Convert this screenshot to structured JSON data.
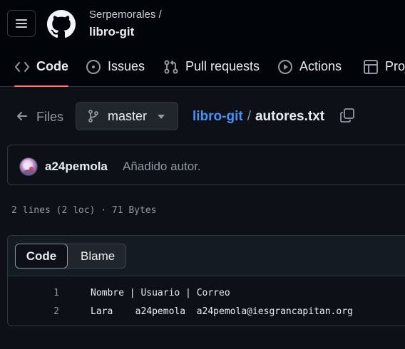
{
  "header": {
    "owner": "Serpemorales /",
    "repo": "libro-git",
    "icons": {
      "menu": "hamburger-icon",
      "logo": "github-logo"
    },
    "tabs": [
      {
        "label": "Code",
        "icon": "code-icon",
        "active": true
      },
      {
        "label": "Issues",
        "icon": "issue-opened-icon",
        "active": false
      },
      {
        "label": "Pull requests",
        "icon": "git-pull-request-icon",
        "active": false
      },
      {
        "label": "Actions",
        "icon": "play-icon",
        "active": false
      },
      {
        "label": "Proj",
        "icon": "table-icon",
        "active": false
      }
    ]
  },
  "filebar": {
    "back_label": "Files",
    "branch": "master",
    "repo_link": "libro-git",
    "separator": "/",
    "file_name": "autores.txt"
  },
  "commit": {
    "author": "a24pemola",
    "message": "Añadido autor."
  },
  "file_meta": "2 lines (2 loc) · 71 Bytes",
  "viewer": {
    "code_tab": "Code",
    "blame_tab": "Blame",
    "lines": [
      {
        "number": "1",
        "text": "Nombre | Usuario | Correo"
      },
      {
        "number": "2",
        "text": "Lara    a24pemola  a24pemola@iesgrancapitan.org"
      }
    ]
  },
  "colors": {
    "background": "#0d1117",
    "header_bg": "#010409",
    "border": "#30363d",
    "accent_underline": "#f78166",
    "link": "#4493f8",
    "muted": "#9198a1"
  }
}
